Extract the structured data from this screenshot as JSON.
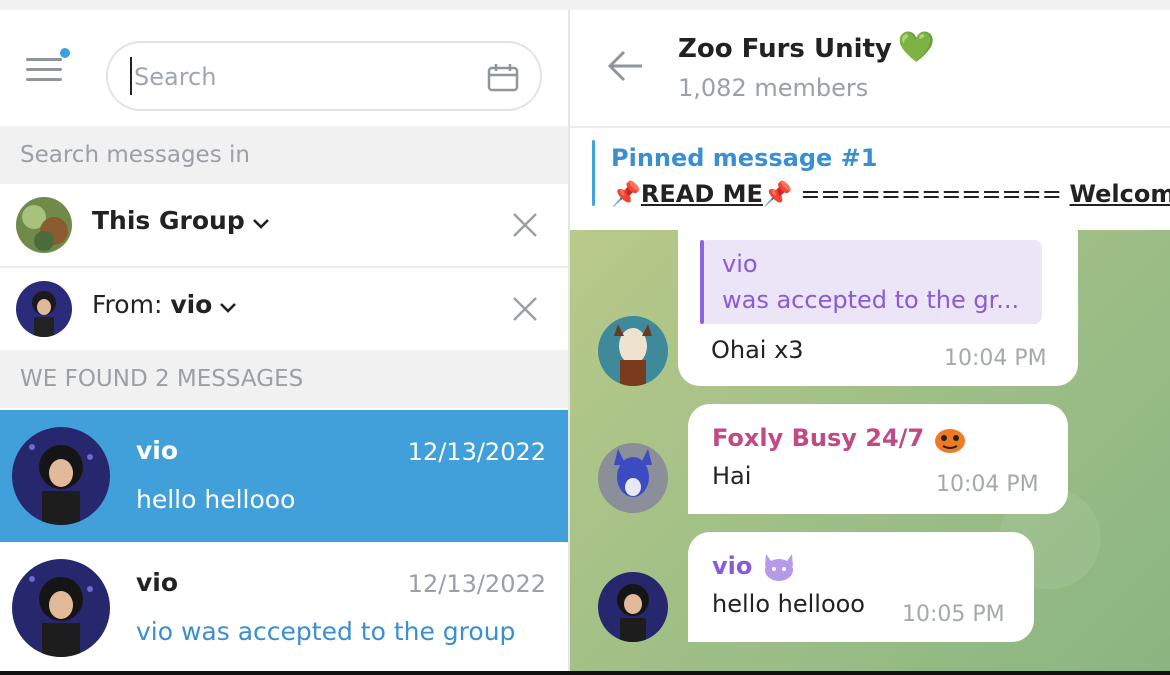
{
  "search": {
    "placeholder": "Search"
  },
  "left": {
    "section_search_in": "Search messages in",
    "filters": [
      {
        "label": "This Group"
      },
      {
        "prefix": "From: ",
        "label": "vio"
      }
    ],
    "section_found": "WE FOUND 2 MESSAGES",
    "results": [
      {
        "name": "vio",
        "date": "12/13/2022",
        "preview": "hello hellooo"
      },
      {
        "name": "vio",
        "date": "12/13/2022",
        "preview": "vio was accepted to the group"
      }
    ]
  },
  "chat": {
    "title": "Zoo Furs Unity",
    "title_emoji": "💚",
    "subtitle": "1,082 members",
    "pinned": {
      "label": "Pinned message #1",
      "read_me": "READ ME",
      "equals": " ============= ",
      "welcome": "Welcome to"
    },
    "messages": [
      {
        "reply_name": "vio",
        "reply_text": "was accepted to the gr...",
        "text": "Ohai x3",
        "time": "10:04 PM"
      },
      {
        "sender": "Foxly Busy 24/7",
        "text": "Hai",
        "time": "10:04 PM"
      },
      {
        "sender": "vio",
        "text": "hello hellooo",
        "time": "10:05 PM"
      }
    ]
  },
  "colors": {
    "accent": "#419fd9",
    "link": "#3a8fd0",
    "purple": "#8a5bd6",
    "pink": "#c04a86"
  }
}
